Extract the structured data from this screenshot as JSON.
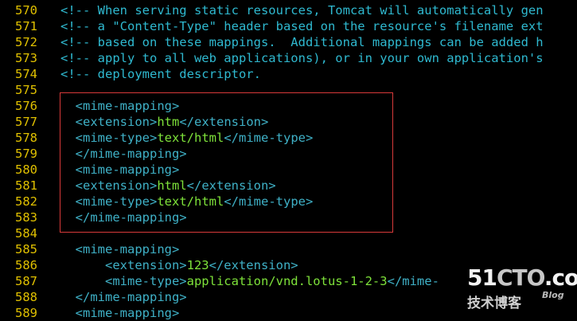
{
  "lines": [
    {
      "num": "570",
      "parts": [
        {
          "t": "<!-- When serving static resources, Tomcat will automatically gen",
          "k": "comment"
        }
      ]
    },
    {
      "num": "571",
      "parts": [
        {
          "t": "<!-- a \"Content-Type\" header based on the resource's filename ext",
          "k": "comment"
        }
      ]
    },
    {
      "num": "572",
      "parts": [
        {
          "t": "<!-- based on these mappings.  Additional mappings can be added h",
          "k": "comment"
        }
      ]
    },
    {
      "num": "573",
      "parts": [
        {
          "t": "<!-- apply to all web applications), or in your own application's",
          "k": "comment"
        }
      ]
    },
    {
      "num": "574",
      "parts": [
        {
          "t": "<!-- deployment descriptor.",
          "k": "comment"
        }
      ]
    },
    {
      "num": "575",
      "parts": []
    },
    {
      "num": "576",
      "parts": [
        {
          "t": "  <mime-mapping>",
          "k": "tag"
        }
      ]
    },
    {
      "num": "577",
      "parts": [
        {
          "t": "  <extension>",
          "k": "tag"
        },
        {
          "t": "htm",
          "k": "val"
        },
        {
          "t": "</extension>",
          "k": "tag"
        }
      ]
    },
    {
      "num": "578",
      "parts": [
        {
          "t": "  <mime-type>",
          "k": "tag"
        },
        {
          "t": "text/html",
          "k": "val"
        },
        {
          "t": "</mime-type>",
          "k": "tag"
        }
      ]
    },
    {
      "num": "579",
      "parts": [
        {
          "t": "  </mime-mapping>",
          "k": "tag"
        }
      ]
    },
    {
      "num": "580",
      "parts": [
        {
          "t": "  <mime-mapping>",
          "k": "tag"
        }
      ]
    },
    {
      "num": "581",
      "parts": [
        {
          "t": "  <extension>",
          "k": "tag"
        },
        {
          "t": "html",
          "k": "val"
        },
        {
          "t": "</extension>",
          "k": "tag"
        }
      ]
    },
    {
      "num": "582",
      "parts": [
        {
          "t": "  <mime-type>",
          "k": "tag"
        },
        {
          "t": "text/html",
          "k": "val"
        },
        {
          "t": "</mime-type>",
          "k": "tag"
        }
      ]
    },
    {
      "num": "583",
      "parts": [
        {
          "t": "  </mime-mapping>",
          "k": "tag"
        }
      ]
    },
    {
      "num": "584",
      "parts": []
    },
    {
      "num": "585",
      "parts": [
        {
          "t": "  <mime-mapping>",
          "k": "tag"
        }
      ]
    },
    {
      "num": "586",
      "parts": [
        {
          "t": "      <extension>",
          "k": "tag"
        },
        {
          "t": "123",
          "k": "val"
        },
        {
          "t": "</extension>",
          "k": "tag"
        }
      ]
    },
    {
      "num": "587",
      "parts": [
        {
          "t": "      <mime-type>",
          "k": "tag"
        },
        {
          "t": "application/vnd.lotus-1-2-3",
          "k": "val"
        },
        {
          "t": "</mime-",
          "k": "tag"
        }
      ]
    },
    {
      "num": "588",
      "parts": [
        {
          "t": "  </mime-mapping>",
          "k": "tag"
        }
      ]
    },
    {
      "num": "589",
      "parts": [
        {
          "t": "  <mime-mapping>",
          "k": "tag"
        }
      ]
    }
  ],
  "watermark": {
    "brand_51": "51",
    "brand_cto": "CTO",
    "brand_com": ".com",
    "subtitle": "技术博客",
    "blog": "Blog"
  }
}
